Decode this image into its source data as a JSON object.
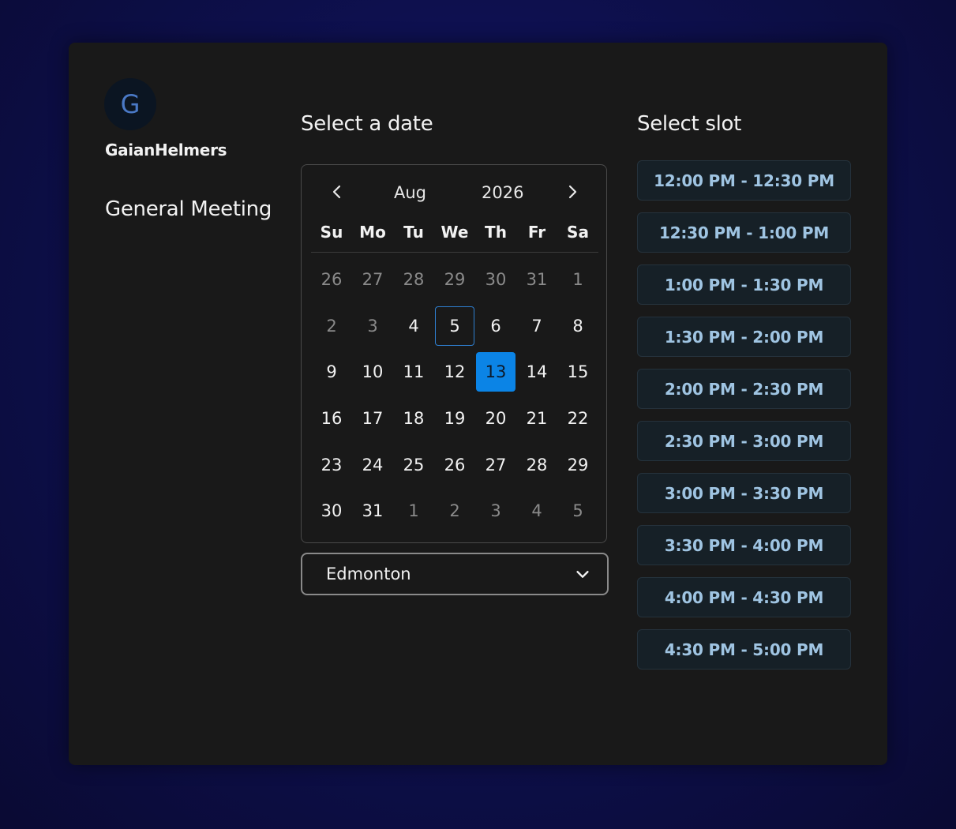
{
  "profile": {
    "avatar_initial": "G",
    "username": "GaianHelmers",
    "event_title": "General Meeting"
  },
  "date_section": {
    "title": "Select a date"
  },
  "calendar": {
    "month": "Aug",
    "year": "2026",
    "weekdays": [
      "Su",
      "Mo",
      "Tu",
      "We",
      "Th",
      "Fr",
      "Sa"
    ],
    "days": [
      {
        "label": "26",
        "muted": true
      },
      {
        "label": "27",
        "muted": true
      },
      {
        "label": "28",
        "muted": true
      },
      {
        "label": "29",
        "muted": true
      },
      {
        "label": "30",
        "muted": true
      },
      {
        "label": "31",
        "muted": true
      },
      {
        "label": "1",
        "muted": true
      },
      {
        "label": "2",
        "muted": true
      },
      {
        "label": "3",
        "muted": true
      },
      {
        "label": "4"
      },
      {
        "label": "5",
        "today": true
      },
      {
        "label": "6"
      },
      {
        "label": "7"
      },
      {
        "label": "8"
      },
      {
        "label": "9"
      },
      {
        "label": "10"
      },
      {
        "label": "11"
      },
      {
        "label": "12"
      },
      {
        "label": "13",
        "selected": true
      },
      {
        "label": "14"
      },
      {
        "label": "15"
      },
      {
        "label": "16"
      },
      {
        "label": "17"
      },
      {
        "label": "18"
      },
      {
        "label": "19"
      },
      {
        "label": "20"
      },
      {
        "label": "21"
      },
      {
        "label": "22"
      },
      {
        "label": "23"
      },
      {
        "label": "24"
      },
      {
        "label": "25"
      },
      {
        "label": "26"
      },
      {
        "label": "27"
      },
      {
        "label": "28"
      },
      {
        "label": "29"
      },
      {
        "label": "30"
      },
      {
        "label": "31"
      },
      {
        "label": "1",
        "muted": true
      },
      {
        "label": "2",
        "muted": true
      },
      {
        "label": "3",
        "muted": true
      },
      {
        "label": "4",
        "muted": true
      },
      {
        "label": "5",
        "muted": true
      }
    ]
  },
  "timezone": {
    "selected": "Edmonton"
  },
  "slot_section": {
    "title": "Select slot",
    "slots": [
      "12:00 PM - 12:30 PM",
      "12:30 PM - 1:00 PM",
      "1:00 PM - 1:30 PM",
      "1:30 PM - 2:00 PM",
      "2:00 PM - 2:30 PM",
      "2:30 PM - 3:00 PM",
      "3:00 PM - 3:30 PM",
      "3:30 PM - 4:00 PM",
      "4:00 PM - 4:30 PM",
      "4:30 PM - 5:00 PM"
    ]
  },
  "colors": {
    "background": "#0d0f4a",
    "card": "#191919",
    "accent": "#0b84e6",
    "slot_text": "#9fc4e2"
  }
}
